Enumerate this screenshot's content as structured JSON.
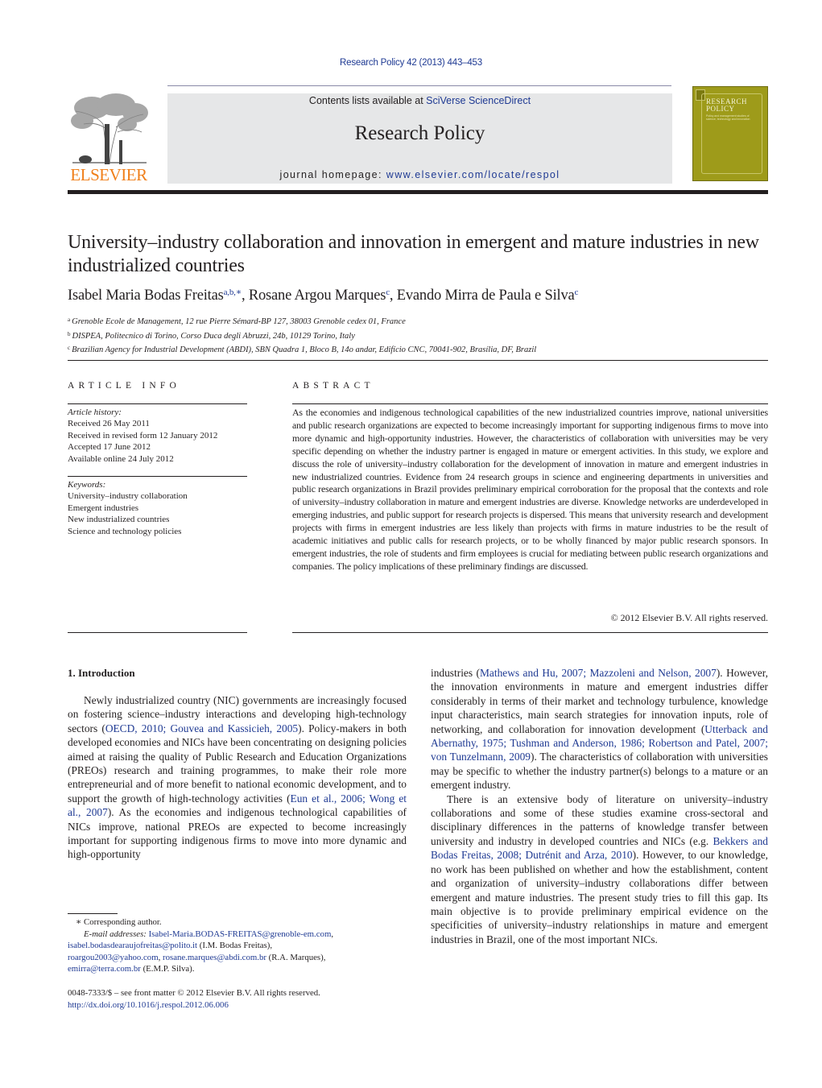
{
  "header": {
    "journal_ref": "Research Policy 42 (2013) 443–453",
    "contents_prefix": "Contents lists available at ",
    "contents_link": "SciVerse ScienceDirect",
    "journal_title": "Research Policy",
    "homepage_prefix": "journal homepage: ",
    "homepage_link": "www.elsevier.com/locate/respol",
    "publisher_logo_text": "ELSEVIER",
    "cover": {
      "title_line1": "RESEARCH",
      "title_line2": "POLICY",
      "subtitle": "Policy and management studies of science, technology and innovation",
      "color": "#9e9b1a"
    },
    "brand_orange": "#f07f1a",
    "link_color": "#1f3a93"
  },
  "article": {
    "title": "University–industry collaboration and innovation in emergent and mature industries in new industrialized countries",
    "authors": [
      {
        "name": "Isabel Maria Bodas Freitas",
        "marks": "a,b,∗",
        "sep": ", "
      },
      {
        "name": "Rosane Argou Marques",
        "marks": "c",
        "sep": ", "
      },
      {
        "name": "Evando Mirra de Paula e Silva",
        "marks": "c",
        "sep": ""
      }
    ],
    "affiliations": [
      {
        "mark": "a",
        "text": "Grenoble Ecole de Management, 12 rue Pierre Sémard-BP 127, 38003 Grenoble cedex 01, France"
      },
      {
        "mark": "b",
        "text": "DISPEA, Politecnico di Torino, Corso Duca degli Abruzzi, 24b, 10129 Torino, Italy"
      },
      {
        "mark": "c",
        "text": "Brazilian Agency for Industrial Development (ABDI), SBN Quadra 1, Bloco B, 14o andar, Edifício CNC, 70041-902, Brasília, DF, Brazil"
      }
    ]
  },
  "article_info": {
    "heading": "ARTICLE INFO",
    "history_label": "Article history:",
    "history": [
      "Received 26 May 2011",
      "Received in revised form 12 January 2012",
      "Accepted 17 June 2012",
      "Available online 24 July 2012"
    ],
    "keywords_label": "Keywords:",
    "keywords": [
      "University–industry collaboration",
      "Emergent industries",
      "New industrialized countries",
      "Science and technology policies"
    ]
  },
  "abstract": {
    "heading": "ABSTRACT",
    "text": "As the economies and indigenous technological capabilities of the new industrialized countries improve, national universities and public research organizations are expected to become increasingly important for supporting indigenous firms to move into more dynamic and high-opportunity industries. However, the characteristics of collaboration with universities may be very specific depending on whether the industry partner is engaged in mature or emergent activities. In this study, we explore and discuss the role of university–industry collaboration for the development of innovation in mature and emergent industries in new industrialized countries. Evidence from 24 research groups in science and engineering departments in universities and public research organizations in Brazil provides preliminary empirical corroboration for the proposal that the contexts and role of university–industry collaboration in mature and emergent industries are diverse. Knowledge networks are underdeveloped in emerging industries, and public support for research projects is dispersed. This means that university research and development projects with firms in emergent industries are less likely than projects with firms in mature industries to be the result of academic initiatives and public calls for research projects, or to be wholly financed by major public research sponsors. In emergent industries, the role of students and firm employees is crucial for mediating between public research organizations and companies. The policy implications of these preliminary findings are discussed.",
    "copyright": "© 2012 Elsevier B.V. All rights reserved."
  },
  "body": {
    "section_heading": "1.  Introduction",
    "left_paragraph": {
      "t1": "Newly industrialized country (NIC) governments are increasingly focused on fostering science–industry interactions and developing high-technology sectors (",
      "c1": "OECD, 2010; Gouvea and Kassicieh, 2005",
      "t2": "). Policy-makers in both developed economies and NICs have been concentrating on designing policies aimed at raising the quality of Public Research and Education Organizations (PREOs) research and training programmes, to make their role more entrepreneurial and of more benefit to national economic development, and to support the growth of high-technology activities (",
      "c2": "Eun et al., 2006; Wong et al., 2007",
      "t3": "). As the economies and indigenous technological capabilities of NICs improve, national PREOs are expected to become increasingly important for supporting indigenous firms to move into more dynamic and high-opportunity"
    },
    "right_paragraph1": {
      "t1": "industries (",
      "c1": "Mathews and Hu, 2007; Mazzoleni and Nelson, 2007",
      "t2": "). However, the innovation environments in mature and emergent industries differ considerably in terms of their market and technology turbulence, knowledge input characteristics, main search strategies for innovation inputs, role of networking, and collaboration for innovation development (",
      "c2": "Utterback and Abernathy, 1975; Tushman and Anderson, 1986; Robertson and Patel, 2007; von Tunzelmann, 2009",
      "t3": "). The characteristics of collaboration with universities may be specific to whether the industry partner(s) belongs to a mature or an emergent industry."
    },
    "right_paragraph2": {
      "t1": "There is an extensive body of literature on university–industry collaborations and some of these studies examine cross-sectoral and disciplinary differences in the patterns of knowledge transfer between university and industry in developed countries and NICs (e.g. ",
      "c1": "Bekkers and Bodas Freitas, 2008; Dutrénit and Arza, 2010",
      "t2": "). However, to our knowledge, no work has been published on whether and how the establishment, content and organization of university–industry collaborations differ between emergent and mature industries. The present study tries to fill this gap. Its main objective is to provide preliminary empirical evidence on the specificities of university–industry relationships in mature and emergent industries in Brazil, one of the most important NICs."
    }
  },
  "footnotes": {
    "corresponding": "∗  Corresponding author.",
    "email_label": "E-mail addresses: ",
    "email1": "Isabel-Maria.BODAS-FREITAS@grenoble-em.com",
    "email1_sep": ",",
    "email2": "isabel.bodasdearaujofreitas@polito.it",
    "email2_owner": " (I.M. Bodas Freitas),",
    "email3": "roargou2003@yahoo.com",
    "email3_sep": ", ",
    "email4": "rosane.marques@abdi.com.br",
    "email4_owner": " (R.A. Marques),",
    "email5": "emirra@terra.com.br",
    "email5_owner": " (E.M.P. Silva).",
    "front_matter": "0048-7333/$ – see front matter © 2012 Elsevier B.V. All rights reserved.",
    "doi": "http://dx.doi.org/10.1016/j.respol.2012.06.006"
  }
}
